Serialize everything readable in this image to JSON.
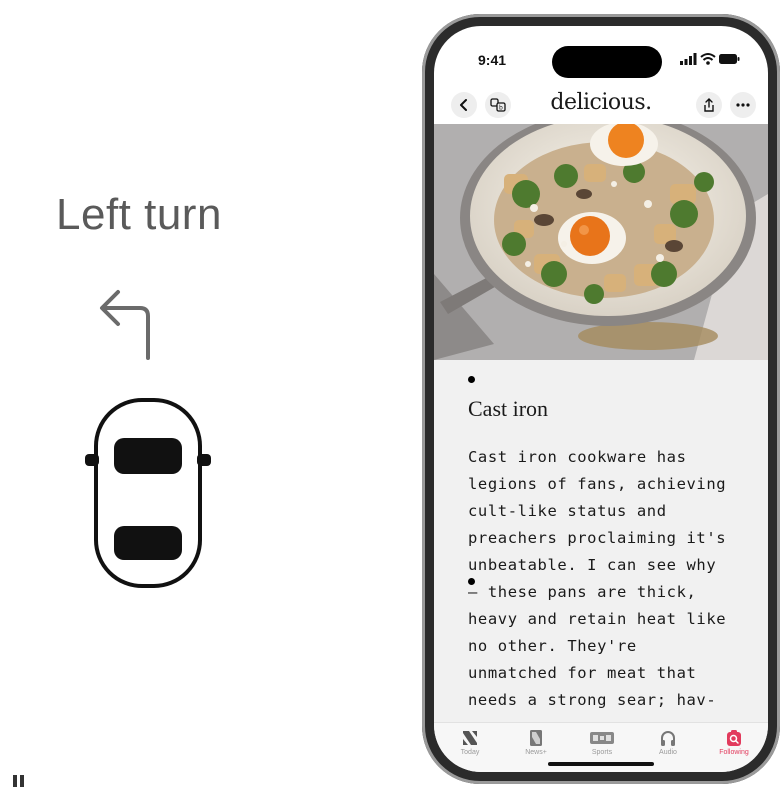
{
  "illustration": {
    "title": "Left turn",
    "arrow_icon": "turn-left-arrow-icon",
    "car_icon": "car-top-view-icon",
    "pause_icon": "pause-icon"
  },
  "phone": {
    "status_bar": {
      "time": "9:41",
      "icons": [
        "cellular-signal-icon",
        "wifi-icon",
        "battery-icon"
      ]
    },
    "nav": {
      "publication": "delicious.",
      "back_icon": "chevron-left-icon",
      "translate_icon": "translate-icon",
      "share_icon": "share-icon",
      "more_icon": "ellipsis-icon"
    },
    "hero_image": "skillet of fried eggs, potatoes and greens",
    "article": {
      "heading": "Cast iron",
      "body": "Cast iron cookware has\nlegions of fans, achieving\ncult-like status and\npreachers proclaiming it's\nunbeatable. I can see why\n– these pans are thick,\nheavy and retain heat like\nno other. They're\nunmatched for meat that\nneeds a strong sear; hav-"
    },
    "tabs": [
      {
        "label": "Today",
        "icon": "news-today-icon",
        "active": false
      },
      {
        "label": "News+",
        "icon": "news-plus-icon",
        "active": false
      },
      {
        "label": "Sports",
        "icon": "sports-scoreboard-icon",
        "active": false
      },
      {
        "label": "Audio",
        "icon": "headphones-icon",
        "active": false
      },
      {
        "label": "Following",
        "icon": "following-search-icon",
        "active": true
      }
    ]
  },
  "colors": {
    "accent": "#e23b5d",
    "title_gray": "#5a5a5a",
    "article_bg": "#f1f1f1"
  }
}
